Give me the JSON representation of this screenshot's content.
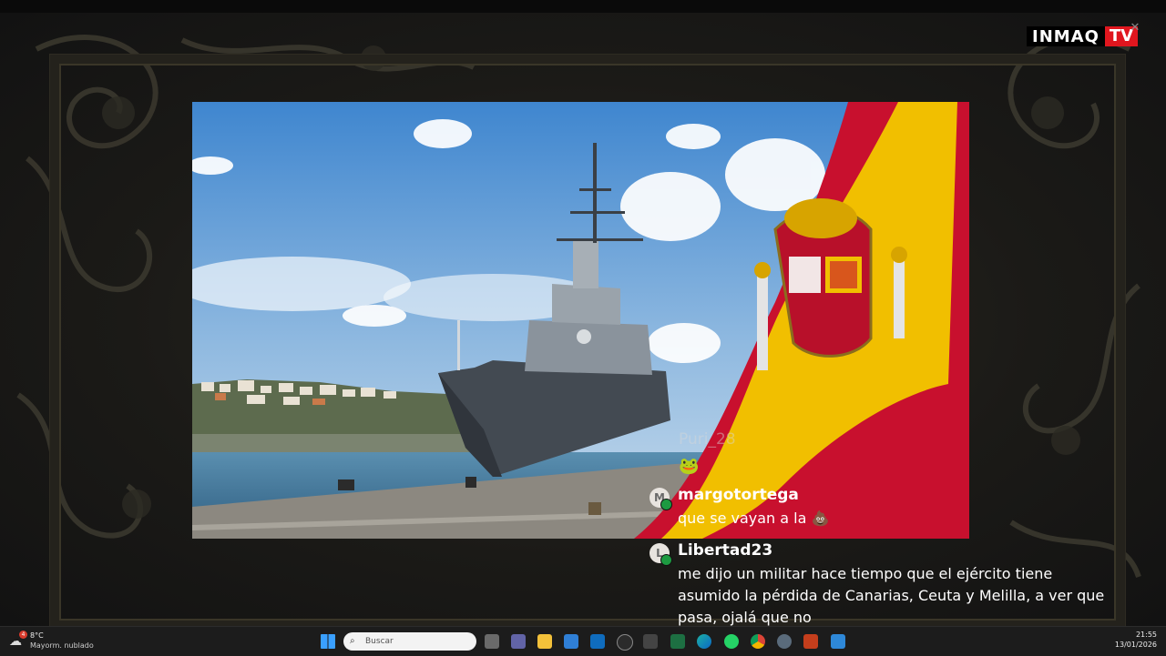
{
  "overlay": {
    "brand": "INMAQ",
    "brand_tv": "TV"
  },
  "chat": {
    "faded_user": "Puri_28",
    "messages": [
      {
        "avatar_letter": "M",
        "user": "margotortega",
        "text": "que se vayan a la"
      },
      {
        "avatar_letter": "L",
        "user": "Libertad23",
        "lines": [
          "me dijo un militar hace tiempo que el ejército tiene",
          "asumido la pérdida de Canarias, Ceuta y Melilla, a ver que",
          "pasa, ojalá que no"
        ]
      }
    ]
  },
  "taskbar": {
    "weather_temp": "8°C",
    "weather_desc": "Mayorm. nublado",
    "weather_badge": "4",
    "search_placeholder": "Buscar",
    "time": "21:55",
    "date": "13/01/2026"
  },
  "colors": {
    "flag_red": "#c8102e",
    "flag_yellow": "#f1bf00",
    "logo_red": "#e0161e"
  }
}
